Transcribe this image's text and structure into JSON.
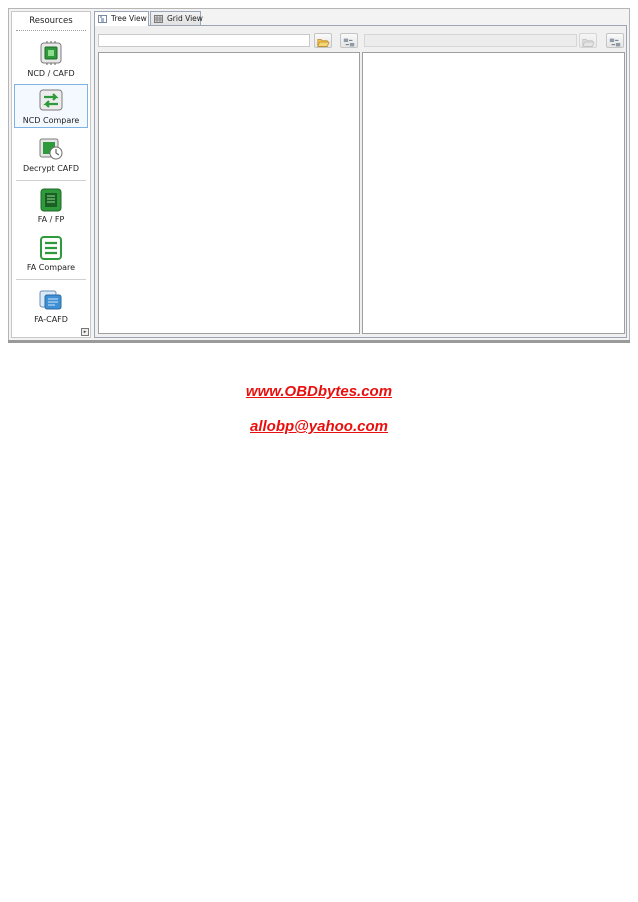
{
  "sidebar": {
    "title": "Resources",
    "items": [
      {
        "label": "NCD / CAFD",
        "icon": "chip-icon"
      },
      {
        "label": "NCD Compare",
        "icon": "compare-arrows-icon"
      },
      {
        "label": "Decrypt CAFD",
        "icon": "decrypt-clock-icon"
      },
      {
        "label": "FA / FP",
        "icon": "fa-fp-document-icon"
      },
      {
        "label": "FA Compare",
        "icon": "fa-compare-list-icon"
      },
      {
        "label": "FA-CAFD",
        "icon": "fa-cafd-stack-icon"
      }
    ],
    "active_index": 1
  },
  "tabs": [
    {
      "label": "Tree View",
      "icon": "tree-view-icon",
      "active": true
    },
    {
      "label": "Grid View",
      "icon": "grid-view-icon",
      "active": false
    }
  ],
  "left_panel": {
    "path_value": "",
    "open_icon": "folder-open-icon",
    "compare_icon": "compare-tool-icon"
  },
  "right_panel": {
    "path_value": "",
    "open_icon": "folder-open-icon",
    "compare_icon": "compare-tool-icon"
  },
  "footer": {
    "website": "www.OBDbytes.com",
    "email": "allobp@yahoo.com"
  },
  "colors": {
    "accent": "#7fb2e5",
    "link": "#e8100e",
    "icon_green": "#2e9a3c"
  }
}
